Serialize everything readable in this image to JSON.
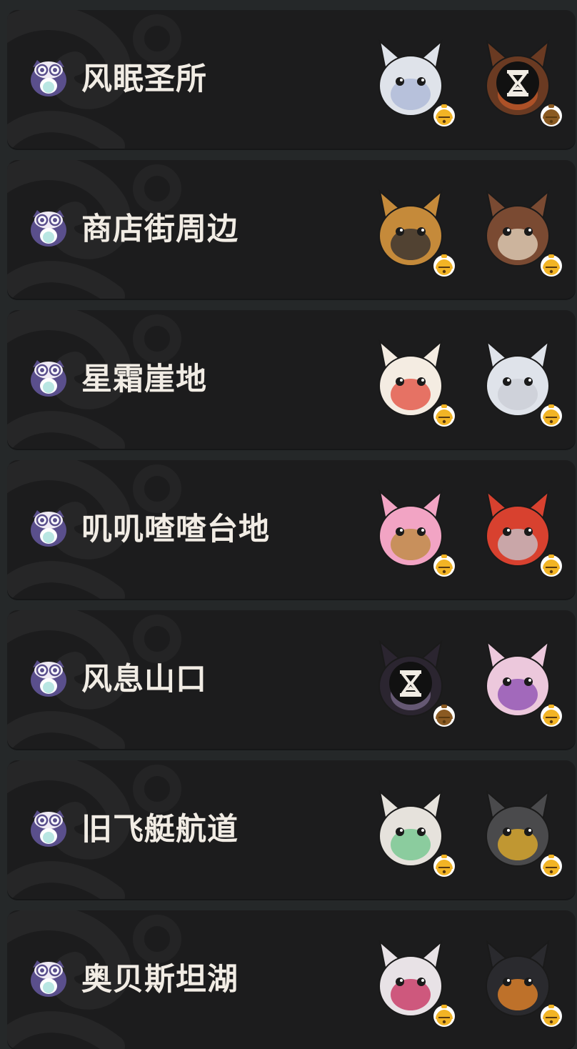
{
  "locations": [
    {
      "name": "风眠圣所",
      "pets": [
        {
          "icon": "white-fox-spirit-icon",
          "bell": "gold-bell-icon",
          "locked": false,
          "body": "#dfe3ea",
          "accent": "#aab6d6"
        },
        {
          "icon": "brown-beast-icon",
          "bell": "bronze-bell-icon",
          "locked": true,
          "body": "#6a3a22",
          "accent": "#c45a2a"
        }
      ]
    },
    {
      "name": "商店街周边",
      "pets": [
        {
          "icon": "mirror-frame-creature-icon",
          "bell": "gold-bell-icon",
          "locked": false,
          "body": "#c58a3a",
          "accent": "#2a2a30"
        },
        {
          "icon": "chestnut-helmet-creature-icon",
          "bell": "gold-bell-icon",
          "locked": false,
          "body": "#7a4a32",
          "accent": "#e8d8c2"
        }
      ]
    },
    {
      "name": "星霜崖地",
      "pets": [
        {
          "icon": "crowned-bunny-icon",
          "bell": "gold-bell-icon",
          "locked": false,
          "body": "#f4ece2",
          "accent": "#e24a3a"
        },
        {
          "icon": "floppy-ear-bunny-icon",
          "bell": "gold-bell-icon",
          "locked": false,
          "body": "#dfe3ea",
          "accent": "#c9ccd4"
        }
      ]
    },
    {
      "name": "叽叽喳喳台地",
      "pets": [
        {
          "icon": "pink-bird-icon",
          "bell": "gold-bell-icon",
          "locked": false,
          "body": "#f2a4c4",
          "accent": "#b98a3a"
        },
        {
          "icon": "red-saucer-robot-icon",
          "bell": "gold-bell-icon",
          "locked": false,
          "body": "#d8412f",
          "accent": "#c4c8d2"
        }
      ]
    },
    {
      "name": "风息山口",
      "pets": [
        {
          "icon": "shadow-fox-icon",
          "bell": "bronze-bell-icon",
          "locked": true,
          "body": "#2b2530",
          "accent": "#7a6a8a"
        },
        {
          "icon": "horned-pink-creature-icon",
          "bell": "gold-bell-icon",
          "locked": false,
          "body": "#ecc8dc",
          "accent": "#8a4ab0"
        }
      ]
    },
    {
      "name": "旧飞艇航道",
      "pets": [
        {
          "icon": "green-mane-unicorn-icon",
          "bell": "gold-bell-icon",
          "locked": false,
          "body": "#e6e2dc",
          "accent": "#6cc48a"
        },
        {
          "icon": "metal-shell-creature-icon",
          "bell": "gold-bell-icon",
          "locked": false,
          "body": "#4a4a4c",
          "accent": "#e8b22a"
        }
      ]
    },
    {
      "name": "奥贝斯坦湖",
      "pets": [
        {
          "icon": "masked-cat-icon",
          "bell": "gold-bell-icon",
          "locked": false,
          "body": "#e8e2e6",
          "accent": "#c62a5a"
        },
        {
          "icon": "dark-beetle-icon",
          "bell": "gold-bell-icon",
          "locked": false,
          "body": "#2a2a2e",
          "accent": "#f08a2a"
        }
      ]
    }
  ],
  "colors": {
    "page_bg": "#252829",
    "card_bg": "#1c1c1d",
    "text": "#f1ece4",
    "owl": "#5a4f8c",
    "owl_belly": "#b8e6e2",
    "gold_bell": "#f2b425",
    "bronze_bell": "#8a5a22"
  },
  "icons": {
    "owl": "owl-icon",
    "lock": "hourglass-icon"
  }
}
